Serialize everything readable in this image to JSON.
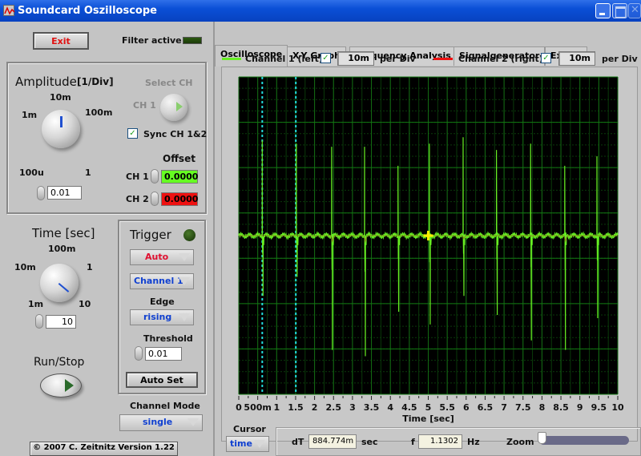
{
  "window": {
    "title": "Soundcard Oszilloscope"
  },
  "left": {
    "exit_label": "Exit",
    "filter_label": "Filter active",
    "amplitude": {
      "title": "Amplitude",
      "unit": "[1/Div]",
      "scale_labels": [
        "100u",
        "1m",
        "10m",
        "100m",
        "1"
      ],
      "value": "0.01"
    },
    "select_ch": {
      "label": "Select CH",
      "ch_label": "CH 1"
    },
    "sync_label": "Sync CH 1&2",
    "sync_checked": true,
    "offset": {
      "title": "Offset",
      "ch1_label": "CH 1",
      "ch1_value": "0.0000",
      "ch2_label": "CH 2",
      "ch2_value": "0.0000"
    },
    "time": {
      "title": "Time [sec]",
      "scale_labels": [
        "1m",
        "10m",
        "100m",
        "1",
        "10"
      ],
      "value": "10"
    },
    "trigger": {
      "title": "Trigger",
      "mode": "Auto",
      "source": "Channel 1",
      "edge_label": "Edge",
      "edge": "rising",
      "threshold_label": "Threshold",
      "threshold": "0.01",
      "autoset_label": "Auto Set"
    },
    "runstop_label": "Run/Stop",
    "channel_mode": {
      "label": "Channel Mode",
      "value": "single"
    },
    "copyright": "© 2007   C. Zeitnitz Version 1.22"
  },
  "tabs": [
    {
      "label": "Oscilloscope",
      "active": true
    },
    {
      "label": "X-Y Graph",
      "active": false
    },
    {
      "label": "Frequency Analysis",
      "active": false
    },
    {
      "label": "Signalgenerator",
      "active": false
    },
    {
      "label": "Extras",
      "active": false
    }
  ],
  "channels": {
    "ch1": {
      "label": "Channel 1 (left)",
      "checked": true,
      "per_div": "10m",
      "per_div_label": "per Div",
      "color": "#66ee22"
    },
    "ch2": {
      "label": "Channel 2 (right)",
      "checked": true,
      "per_div": "10m",
      "per_div_label": "per Div",
      "color": "#ee1111"
    }
  },
  "bottom": {
    "cursor_label": "Cursor",
    "cursor_mode": "time",
    "dt_label": "dT",
    "dt_value": "884.774m",
    "dt_unit": "sec",
    "f_label": "f",
    "f_value": "1.1302",
    "f_unit": "Hz",
    "zoom_label": "Zoom",
    "zoom_fraction": 0.0
  },
  "chart_data": {
    "type": "line",
    "xlabel": "Time [sec]",
    "xlim": [
      0,
      10
    ],
    "x_ticks": [
      "0",
      "500m",
      "1",
      "1.5",
      "2",
      "2.5",
      "3",
      "3.5",
      "4",
      "4.5",
      "5",
      "5.5",
      "6",
      "6.5",
      "7",
      "7.5",
      "8",
      "8.5",
      "9",
      "9.5",
      "10"
    ],
    "ylim": [
      -5,
      5
    ],
    "grid": true,
    "baseline": 0.0,
    "series": [
      {
        "name": "Channel 1 (left)",
        "spike_times": [
          0.62,
          1.52,
          2.45,
          3.32,
          4.2,
          5.03,
          5.92,
          6.8,
          7.7,
          8.6,
          9.45
        ],
        "spike_up": [
          3.0,
          2.9,
          2.8,
          2.8,
          2.2,
          2.9,
          3.1,
          2.7,
          2.9,
          2.2,
          2.5
        ],
        "spike_down": [
          -1.9,
          -1.3,
          -3.6,
          -3.8,
          -2.4,
          -2.8,
          -1.9,
          -2.5,
          -3.3,
          -3.6,
          -2.6
        ]
      }
    ],
    "cursors": [
      0.62,
      1.505
    ],
    "cursor_marker_time": 5.0
  }
}
